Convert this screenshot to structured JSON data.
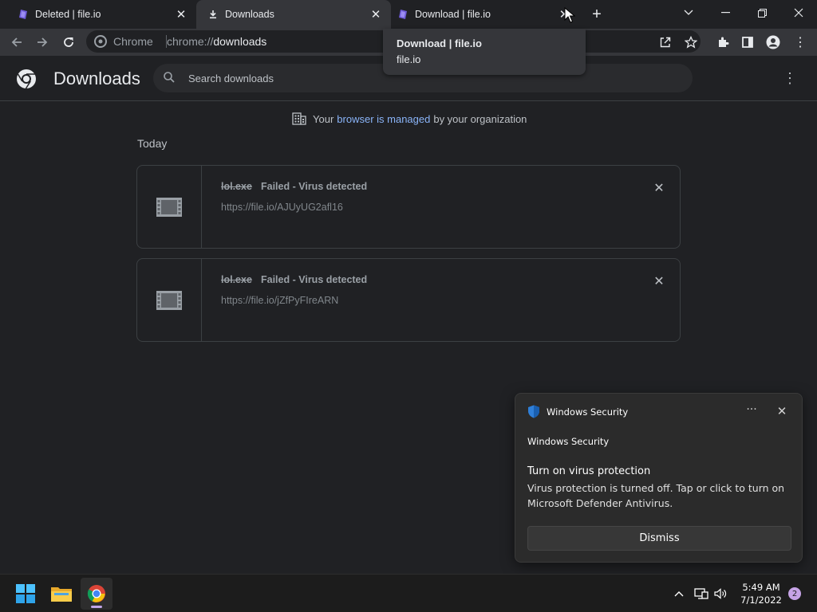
{
  "tabs": [
    {
      "title": "Deleted | file.io",
      "favicon": "fileio-icon"
    },
    {
      "title": "Downloads",
      "favicon": "download-icon",
      "active": true
    },
    {
      "title": "Download | file.io",
      "favicon": "fileio-icon"
    }
  ],
  "hovercard": {
    "title": "Download | file.io",
    "domain": "file.io"
  },
  "omnibox": {
    "chip": "Chrome",
    "url_scheme": "chrome://",
    "url_host": "downloads"
  },
  "downloads_page": {
    "title": "Downloads",
    "search_placeholder": "Search downloads",
    "managed": {
      "prefix": "Your",
      "link": "browser is managed",
      "suffix": "by your organization"
    },
    "section": "Today",
    "items": [
      {
        "filename": "lol.exe",
        "status": "Failed - Virus detected",
        "url": "https://file.io/AJUyUG2afl16"
      },
      {
        "filename": "lol.exe",
        "status": "Failed - Virus detected",
        "url": "https://file.io/jZfPyFIreARN"
      }
    ]
  },
  "toast": {
    "app": "Windows Security",
    "more": "···",
    "subtitle": "Windows Security",
    "heading": "Turn on virus protection",
    "body": "Virus protection is turned off. Tap or click to turn on Microsoft Defender Antivirus.",
    "button": "Dismiss"
  },
  "taskbar": {
    "time": "5:49 AM",
    "date": "7/1/2022",
    "notification_count": "2"
  },
  "colors": {
    "accent": "#8ab4f8",
    "background": "#202124",
    "toolbar": "#35363a"
  }
}
